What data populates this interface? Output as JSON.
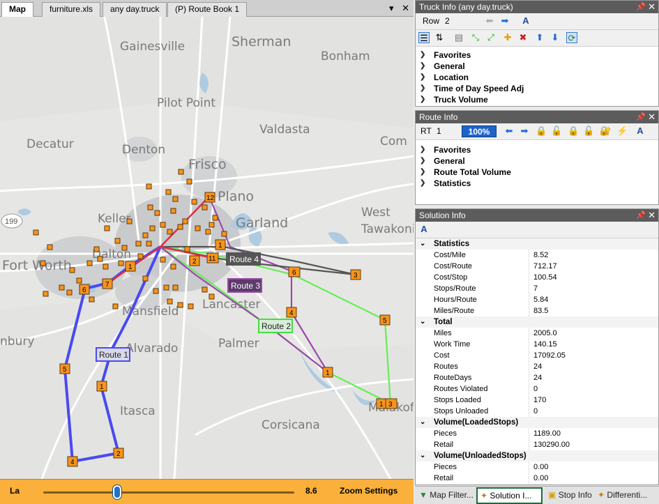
{
  "doc_tabs": {
    "items": [
      "Map",
      "furniture.xls",
      "any day.truck",
      "(P) Route Book 1"
    ],
    "pin_glyph": "▾",
    "close_glyph": "✕"
  },
  "map": {
    "cities": [
      "Gainesville",
      "Sherman",
      "Bonham",
      "Pilot Point",
      "Valdasta",
      "Decatur",
      "Denton",
      "Frisco",
      "Com",
      "Plano",
      "Keller",
      "Garland",
      "West",
      "Tawakoni",
      "Fort Worth",
      "Dalton",
      "Mansfield",
      "Lancaster",
      "Alvarado",
      "Palmer",
      "nbury",
      "Itasca",
      "Corsicana",
      "Malakoff",
      "199"
    ],
    "route_labels": [
      "Route 1",
      "Route 2",
      "Route 3",
      "Route 4"
    ],
    "stop_labels": [
      "12",
      "1",
      "7",
      "6",
      "2",
      "11",
      "1",
      "6",
      "3",
      "4",
      "5",
      "1",
      "5",
      "1",
      "2",
      "4",
      "1",
      "3"
    ],
    "colors": {
      "route1": "#4a4af0",
      "route2": "#66ee55",
      "route3": "#9a4aa8",
      "route4": "#555555",
      "stem": "#e03040",
      "stop": "#f7941d"
    }
  },
  "zoom": {
    "left_label": "La",
    "value": "8.6",
    "settings_label": "Zoom Settings",
    "level_fraction": 0.3
  },
  "truck_info": {
    "title": "Truck Info (any day.truck)",
    "row_label": "Row",
    "row_value": "2",
    "groups": [
      "Favorites",
      "General",
      "Location",
      "Time of Day Speed Adj",
      "Truck Volume"
    ]
  },
  "route_info": {
    "title": "Route Info",
    "rt_label": "RT",
    "rt_value": "1",
    "percent": "100%",
    "groups": [
      "Favorites",
      "General",
      "Route Total Volume",
      "Statistics"
    ]
  },
  "solution_info": {
    "title": "Solution Info",
    "sections": [
      {
        "name": "Statistics",
        "rows": [
          [
            "Cost/Mile",
            "8.52"
          ],
          [
            "Cost/Route",
            "712.17"
          ],
          [
            "Cost/Stop",
            "100.54"
          ],
          [
            "Stops/Route",
            "7"
          ],
          [
            "Hours/Route",
            "5.84"
          ],
          [
            "Miles/Route",
            "83.5"
          ]
        ]
      },
      {
        "name": "Total",
        "rows": [
          [
            "Miles",
            "2005.0"
          ],
          [
            "Work Time",
            "140.15"
          ],
          [
            "Cost",
            "17092.05"
          ],
          [
            "Routes",
            "24"
          ],
          [
            "RouteDays",
            "24"
          ],
          [
            "Routes Violated",
            "0"
          ],
          [
            "Stops Loaded",
            "170"
          ],
          [
            "Stops Unloaded",
            "0"
          ]
        ]
      },
      {
        "name": "Volume(LoadedStops)",
        "rows": [
          [
            "Pieces",
            "1189.00"
          ],
          [
            "Retail",
            "130290.00"
          ]
        ]
      },
      {
        "name": "Volume(UnloadedStops)",
        "rows": [
          [
            "Pieces",
            "0.00"
          ],
          [
            "Retail",
            "0.00"
          ]
        ]
      }
    ]
  },
  "bottom_tabs": [
    "Map Filter...",
    "Solution I...",
    "Stop Info",
    "Differenti..."
  ],
  "panel_controls": {
    "pin": "📌",
    "close": "✕"
  }
}
